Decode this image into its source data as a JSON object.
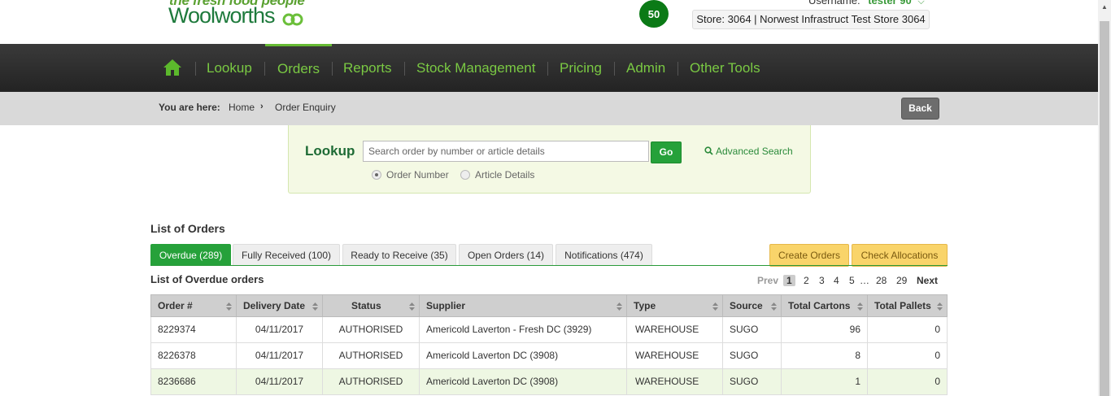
{
  "header": {
    "logo_tagline": "the fresh food people",
    "logo_name": "Woolworths",
    "notification_count": "50",
    "username_label": "Username:",
    "username": "tester 90",
    "store": "Store: 3064 | Norwest Infrastruct Test Store 3064"
  },
  "nav": {
    "home_icon": "home-icon",
    "items": [
      "Lookup",
      "Orders",
      "Reports",
      "Stock Management",
      "Pricing",
      "Admin",
      "Other Tools"
    ],
    "active": "Orders"
  },
  "breadcrumb": {
    "label": "You are here:",
    "home": "Home",
    "current": "Order Enquiry",
    "back": "Back"
  },
  "lookup": {
    "title": "Lookup",
    "placeholder": "Search order by number or article details",
    "go": "Go",
    "advanced": "Advanced Search",
    "radio_order": "Order Number",
    "radio_article": "Article Details",
    "selected": "Order Number"
  },
  "orders": {
    "title": "List of Orders",
    "tabs": [
      "Overdue (289)",
      "Fully Received (100)",
      "Ready to Receive (35)",
      "Open Orders (14)",
      "Notifications (474)"
    ],
    "active_tab": "Overdue (289)",
    "actions": [
      "Create Orders",
      "Check Allocations"
    ],
    "list_title": "List of Overdue orders",
    "pager": {
      "prev": "Prev",
      "pages": [
        "1",
        "2",
        "3",
        "4",
        "5",
        "…",
        "28",
        "29"
      ],
      "current": "1",
      "next": "Next"
    },
    "columns": [
      "Order #",
      "Delivery Date",
      "Status",
      "Supplier",
      "Type",
      "Source",
      "Total Cartons",
      "Total Pallets"
    ],
    "rows": [
      [
        "8229374",
        "04/11/2017",
        "AUTHORISED",
        "Americold Laverton - Fresh DC (3929)",
        "WAREHOUSE",
        "SUGO",
        "96",
        "0"
      ],
      [
        "8226378",
        "04/11/2017",
        "AUTHORISED",
        "Americold Laverton DC (3908)",
        "WAREHOUSE",
        "SUGO",
        "8",
        "0"
      ],
      [
        "8236686",
        "04/11/2017",
        "AUTHORISED",
        "Americold Laverton DC (3908)",
        "WAREHOUSE",
        "SUGO",
        "1",
        "0"
      ]
    ]
  },
  "colors": {
    "brand_green": "#26a13a",
    "nav_text": "#7ac943",
    "action_yellow": "#f9d46a"
  }
}
